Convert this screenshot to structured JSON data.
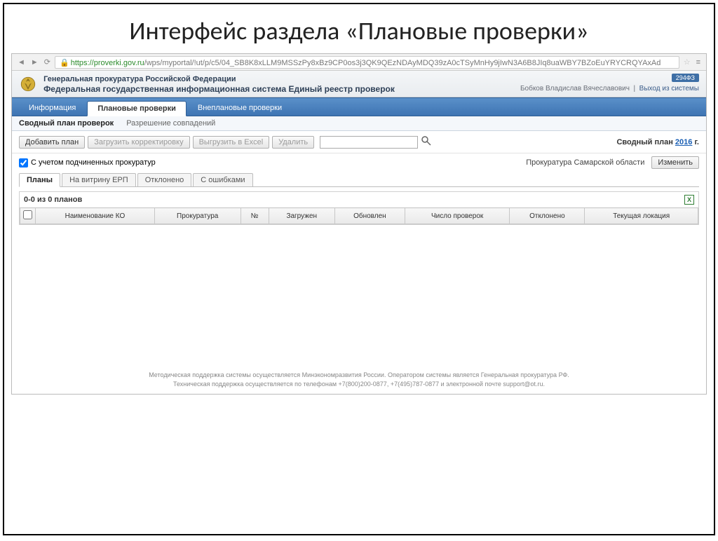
{
  "slide": {
    "title": "Интерфейс раздела «Плановые проверки»"
  },
  "browser": {
    "url_host": "https://proverki.gov.ru",
    "url_path": "/wps/myportal/!ut/p/c5/04_SB8K8xLLM9MSSzPy8xBz9CP0os3j3QK9QEzNDAyMDQ39zA0cTSyMnHy9jIwN3A6B8JIq8uaWBY7BZoEuYRYCRQYAxAd"
  },
  "header": {
    "title1": "Генеральная прокуратура Российской Федерации",
    "title2": "Федеральная государственная информационная система Единый реестр проверок",
    "badge": "294ФЗ",
    "user": "Бобков Владислав Вячеславович",
    "logout": "Выход из системы"
  },
  "tabs": {
    "info": "Информация",
    "planned": "Плановые проверки",
    "unplanned": "Внеплановые проверки"
  },
  "subtabs": {
    "summary": "Сводный план проверок",
    "dupes": "Разрешение совпадений"
  },
  "toolbar": {
    "add": "Добавить план",
    "load": "Загрузить корректировку",
    "excel": "Выгрузить в Excel",
    "delete": "Удалить",
    "summary_label": "Сводный план",
    "year": "2016",
    "year_suffix": "г."
  },
  "checkbox": {
    "label": "С учетом подчиненных прокуратур",
    "org": "Прокуратура Самарской области",
    "change": "Изменить"
  },
  "inner_tabs": {
    "plans": "Планы",
    "erp": "На витрину ЕРП",
    "rejected": "Отклонено",
    "errors": "С ошибками"
  },
  "grid": {
    "count": "0-0 из 0 планов",
    "cols": {
      "name": "Наименование КО",
      "proc": "Прокуратура",
      "num": "№",
      "uploaded": "Загружен",
      "updated": "Обновлен",
      "checks": "Число проверок",
      "rejected": "Отклонено",
      "location": "Текущая локация"
    }
  },
  "footer": {
    "l1": "Методическая поддержка системы осуществляется Минэкономразвития России. Оператором системы является Генеральная прокуратура РФ.",
    "l2": "Техническая поддержка осуществляется по телефонам +7(800)200-0877, +7(495)787-0877 и электронной почте support@ot.ru."
  }
}
